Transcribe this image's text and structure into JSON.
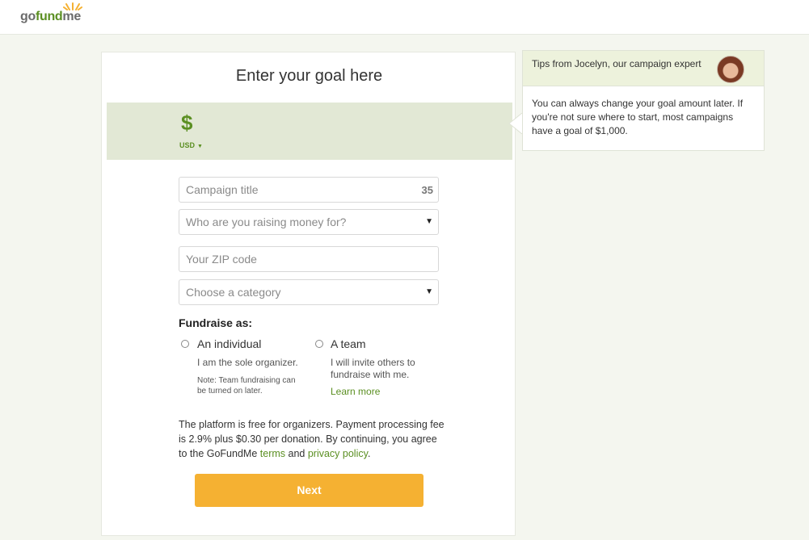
{
  "logo": {
    "go": "go",
    "fund": "fund",
    "me": "me"
  },
  "colors": {
    "brand_green": "#5b8f22",
    "next_button": "#f5b132",
    "amount_band": "#e2e8d5",
    "tips_header": "#edf2dc"
  },
  "goal": {
    "heading": "Enter your goal here",
    "currency_symbol": "$",
    "currency_code": "USD"
  },
  "form": {
    "campaign_title_placeholder": "Campaign title",
    "campaign_title_remaining": "35",
    "beneficiary_placeholder": "Who are you raising money for?",
    "zip_placeholder": "Your ZIP code",
    "category_placeholder": "Choose a category"
  },
  "fundraise_as": {
    "label": "Fundraise as:",
    "individual": {
      "title": "An individual",
      "desc": "I am the sole organizer.",
      "note_line1": "Note: Team fundraising can",
      "note_line2": "be turned on later."
    },
    "team": {
      "title": "A team",
      "desc_line1": "I will invite others to",
      "desc_line2": "fundraise with me.",
      "learn_more": "Learn more"
    }
  },
  "disclaimer": {
    "line1": "The platform is free for organizers. Payment processing fee",
    "line2": "is 2.9% plus $0.30 per donation. By continuing, you agree",
    "line3_prefix": "to the GoFundMe ",
    "terms": "terms",
    "and": " and ",
    "privacy": "privacy policy",
    "end": "."
  },
  "next_label": "Next",
  "tips": {
    "title": "Tips from Jocelyn, our campaign expert",
    "line1": "You can always change your goal amount later. If",
    "line2": "you're not sure where to start, most campaigns",
    "line3": "have a goal of $1,000."
  }
}
